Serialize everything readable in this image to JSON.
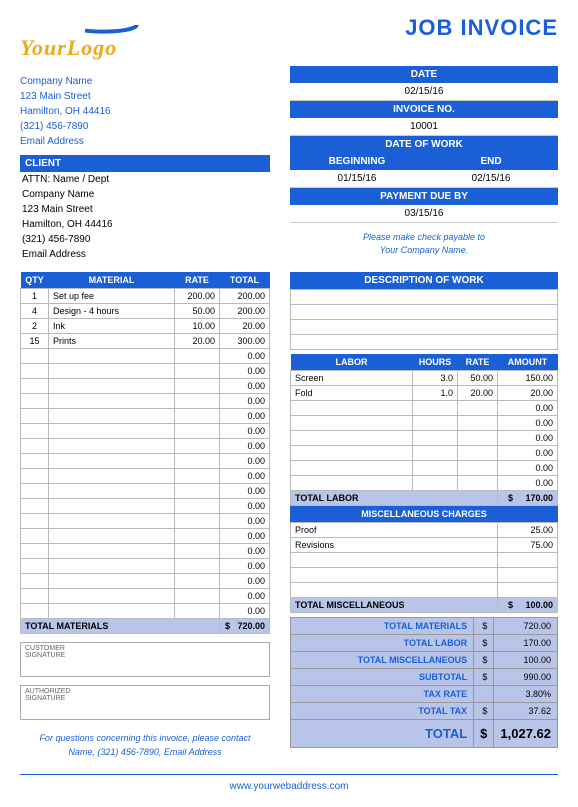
{
  "logo_text": "YourLogo",
  "title": "JOB INVOICE",
  "company": {
    "name": "Company Name",
    "street": "123 Main Street",
    "city": "Hamilton, OH  44416",
    "phone": "(321) 456-7890",
    "email": "Email Address"
  },
  "headers": {
    "date": "DATE",
    "invoice_no": "INVOICE NO.",
    "date_of_work": "DATE OF WORK",
    "beginning": "BEGINNING",
    "end": "END",
    "payment_due": "PAYMENT DUE BY",
    "client": "CLIENT",
    "desc_work": "DESCRIPTION OF WORK",
    "qty": "QTY",
    "material": "MATERIAL",
    "rate": "RATE",
    "total": "TOTAL",
    "labor": "LABOR",
    "hours": "HOURS",
    "amount": "AMOUNT",
    "misc": "MISCELLANEOUS CHARGES"
  },
  "meta": {
    "date": "02/15/16",
    "invoice_no": "10001",
    "beginning": "01/15/16",
    "end": "02/15/16",
    "due": "03/15/16"
  },
  "client": {
    "attn": "ATTN: Name / Dept",
    "name": "Company Name",
    "street": "123 Main Street",
    "city": "Hamilton, OH  44416",
    "phone": "(321) 456-7890",
    "email": "Email Address"
  },
  "payable": {
    "line1": "Please make check payable to",
    "line2": "Your Company Name."
  },
  "materials": [
    {
      "qty": "1",
      "name": "Set up fee",
      "rate": "200.00",
      "total": "200.00"
    },
    {
      "qty": "4",
      "name": "Design - 4 hours",
      "rate": "50.00",
      "total": "200.00"
    },
    {
      "qty": "2",
      "name": "Ink",
      "rate": "10.00",
      "total": "20.00"
    },
    {
      "qty": "15",
      "name": "Prints",
      "rate": "20.00",
      "total": "300.00"
    }
  ],
  "materials_empty_rows": 18,
  "materials_total_label": "TOTAL MATERIALS",
  "materials_total": "720.00",
  "labor": [
    {
      "name": "Screen",
      "hours": "3.0",
      "rate": "50.00",
      "amount": "150.00"
    },
    {
      "name": "Fold",
      "hours": "1.0",
      "rate": "20.00",
      "amount": "20.00"
    }
  ],
  "labor_empty_rows": 6,
  "labor_total_label": "TOTAL LABOR",
  "labor_total": "170.00",
  "misc": [
    {
      "name": "Proof",
      "amount": "25.00"
    },
    {
      "name": "Revisions",
      "amount": "75.00"
    }
  ],
  "misc_empty_rows": 3,
  "misc_total_label": "TOTAL MISCELLANEOUS",
  "misc_total": "100.00",
  "summary": {
    "mat_lbl": "TOTAL MATERIALS",
    "mat": "720.00",
    "lab_lbl": "TOTAL LABOR",
    "lab": "170.00",
    "misc_lbl": "TOTAL MISCELLANEOUS",
    "misc": "100.00",
    "sub_lbl": "SUBTOTAL",
    "sub": "990.00",
    "tax_rate_lbl": "TAX RATE",
    "tax_rate": "3.80%",
    "tax_lbl": "TOTAL TAX",
    "tax": "37.62",
    "total_lbl": "TOTAL",
    "total": "1,027.62"
  },
  "sig": {
    "customer": "CUSTOMER\nSIGNATURE",
    "authorized": "AUTHORIZED\nSIGNATURE"
  },
  "contact": {
    "line1": "For questions concerning this invoice, please contact",
    "line2": "Name, (321) 456-7890, Email Address"
  },
  "footer_url": "www.yourwebaddress.com",
  "currency": "$",
  "zero": "0.00"
}
